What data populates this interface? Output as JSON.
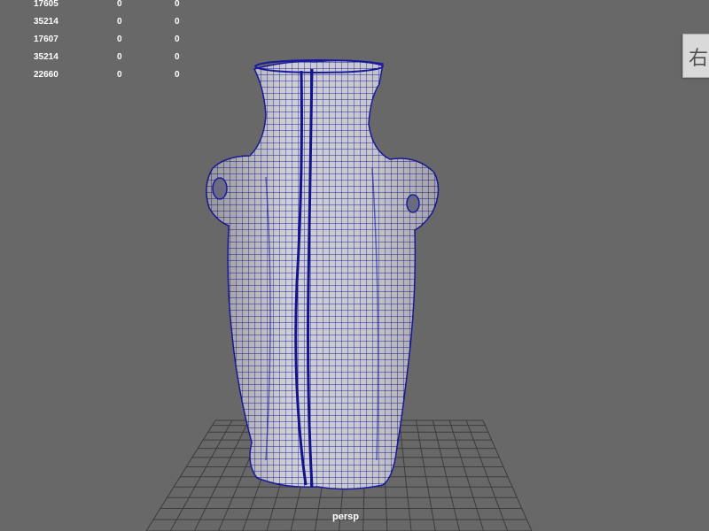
{
  "viewport": {
    "camera": "persp",
    "background_color": "#686868",
    "wireframe_color": "#1a1aa0",
    "grid_color": "#3c3c3c"
  },
  "hud": {
    "rows": [
      [
        "17605",
        "0",
        "0"
      ],
      [
        "35214",
        "0",
        "0"
      ],
      [
        "17607",
        "0",
        "0"
      ],
      [
        "35214",
        "0",
        "0"
      ],
      [
        "22660",
        "0",
        "0"
      ]
    ]
  },
  "viewcube": {
    "face_label": "右"
  }
}
